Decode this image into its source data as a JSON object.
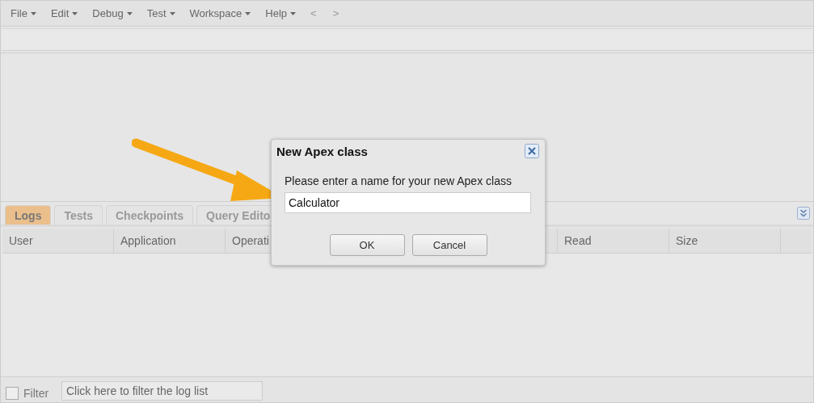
{
  "menu": [
    {
      "label": "File",
      "kind": "menu"
    },
    {
      "label": "Edit",
      "kind": "menu"
    },
    {
      "label": "Debug",
      "kind": "menu"
    },
    {
      "label": "Test",
      "kind": "menu"
    },
    {
      "label": "Workspace",
      "kind": "menu"
    },
    {
      "label": "Help",
      "kind": "menu"
    },
    {
      "label": "<",
      "kind": "nav"
    },
    {
      "label": ">",
      "kind": "nav"
    }
  ],
  "tabs": [
    {
      "label": "Logs",
      "selected": true
    },
    {
      "label": "Tests",
      "selected": false
    },
    {
      "label": "Checkpoints",
      "selected": false
    },
    {
      "label": "Query Edito",
      "selected": false
    }
  ],
  "table": {
    "columns": [
      "User",
      "Application",
      "Operati",
      "Read",
      "Size"
    ]
  },
  "filter": {
    "label": "Filter",
    "checked": false,
    "placeholder": "Click here to filter the log list"
  },
  "dialog": {
    "title": "New Apex class",
    "prompt": "Please enter a name for your new Apex class",
    "value": "Calculator",
    "buttons": [
      "OK",
      "Cancel"
    ]
  }
}
